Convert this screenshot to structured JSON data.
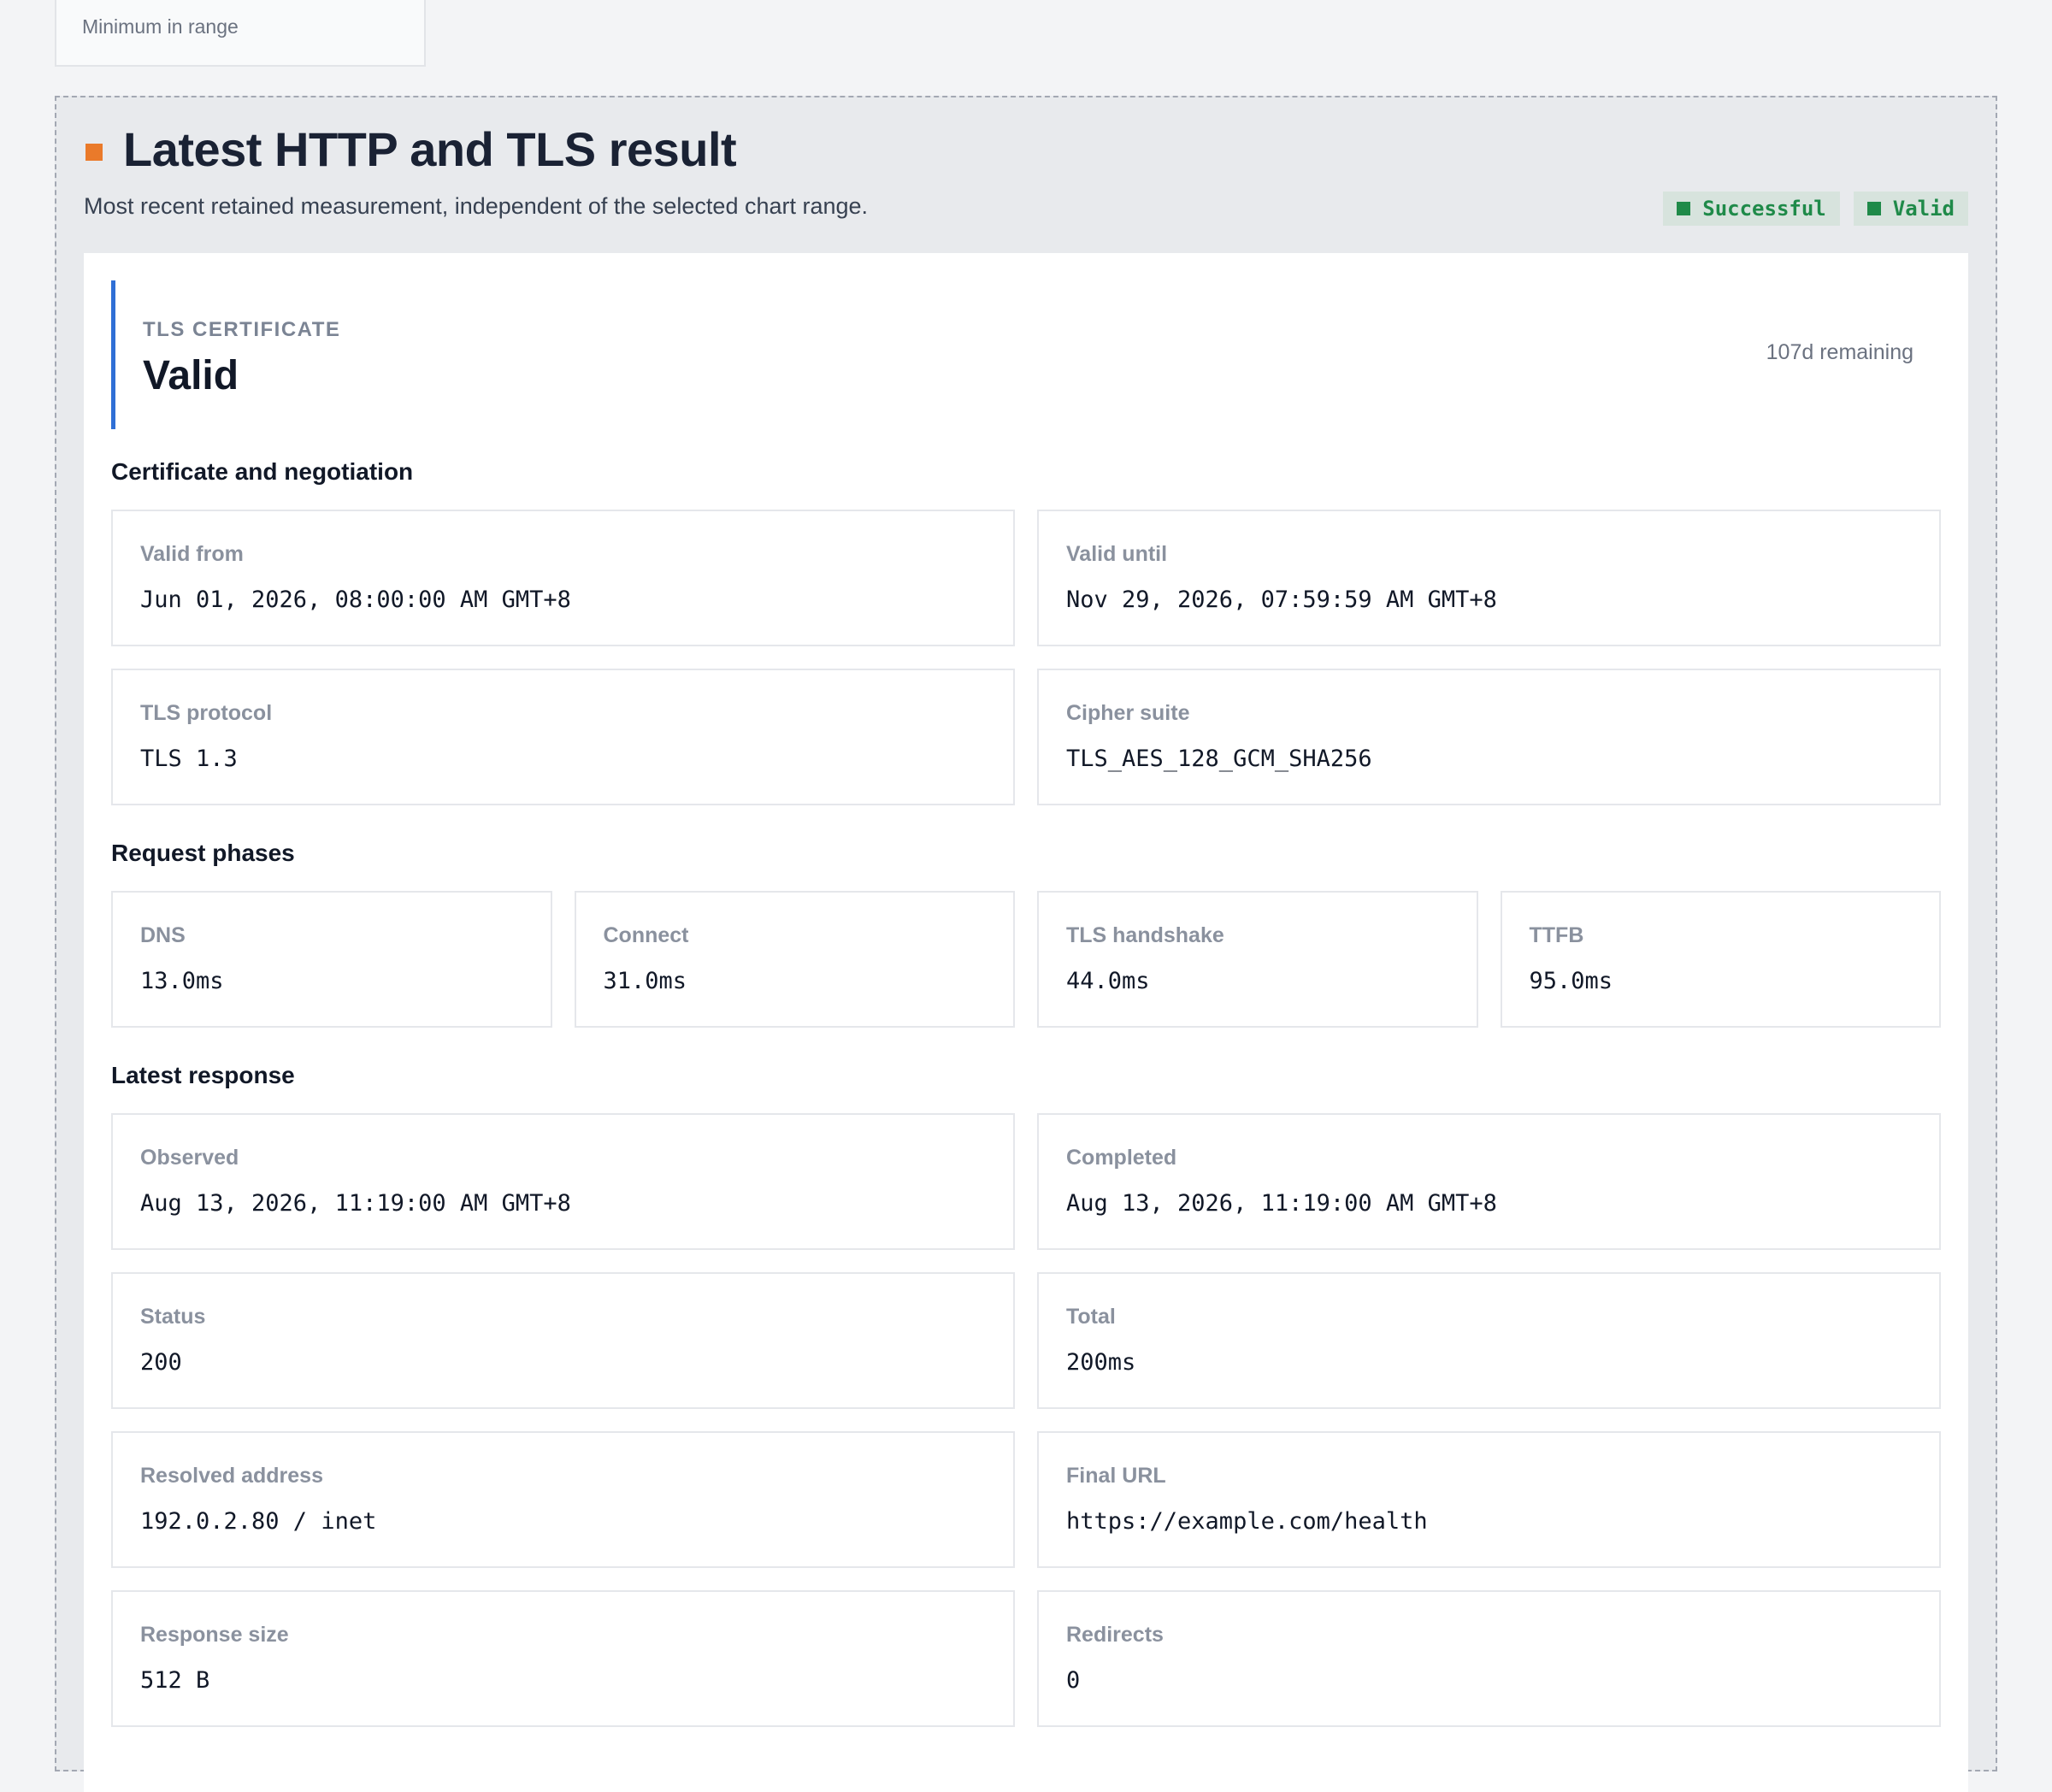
{
  "previous_card": {
    "label": "Minimum in range"
  },
  "section": {
    "title": "Latest HTTP and TLS result",
    "subtitle": "Most recent retained measurement, independent of the selected chart range.",
    "badges": [
      {
        "label": "Successful",
        "color": "#1f8a49"
      },
      {
        "label": "Valid",
        "color": "#1f8a49"
      }
    ],
    "marker_color": "#ea7a2a"
  },
  "certificate": {
    "kicker": "TLS CERTIFICATE",
    "status": "Valid",
    "remaining": "107d remaining",
    "accent_color": "#2f6fd6"
  },
  "groups": {
    "negotiation": {
      "heading": "Certificate and negotiation",
      "items": [
        {
          "label": "Valid from",
          "value": "Jun 01, 2026, 08:00:00 AM GMT+8"
        },
        {
          "label": "Valid until",
          "value": "Nov 29, 2026, 07:59:59 AM GMT+8"
        },
        {
          "label": "TLS protocol",
          "value": "TLS 1.3"
        },
        {
          "label": "Cipher suite",
          "value": "TLS_AES_128_GCM_SHA256"
        }
      ]
    },
    "phases": {
      "heading": "Request phases",
      "items": [
        {
          "label": "DNS",
          "value": "13.0ms"
        },
        {
          "label": "Connect",
          "value": "31.0ms"
        },
        {
          "label": "TLS handshake",
          "value": "44.0ms"
        },
        {
          "label": "TTFB",
          "value": "95.0ms"
        }
      ]
    },
    "response": {
      "heading": "Latest response",
      "items": [
        {
          "label": "Observed",
          "value": "Aug 13, 2026, 11:19:00 AM GMT+8"
        },
        {
          "label": "Completed",
          "value": "Aug 13, 2026, 11:19:00 AM GMT+8"
        },
        {
          "label": "Status",
          "value": "200"
        },
        {
          "label": "Total",
          "value": "200ms"
        },
        {
          "label": "Resolved address",
          "value": "192.0.2.80 / inet"
        },
        {
          "label": "Final URL",
          "value": "https://example.com/health"
        },
        {
          "label": "Response size",
          "value": "512 B"
        },
        {
          "label": "Redirects",
          "value": "0"
        }
      ]
    }
  }
}
